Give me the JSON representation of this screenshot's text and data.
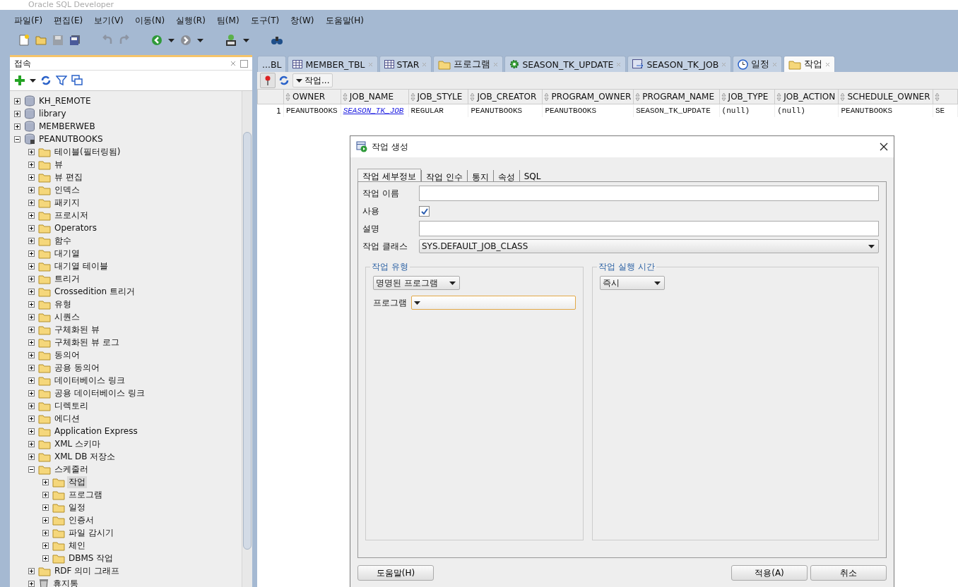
{
  "window": {
    "title": "Oracle SQL Developer"
  },
  "menu": [
    "파일(F)",
    "편집(E)",
    "보기(V)",
    "이동(N)",
    "실행(R)",
    "팀(M)",
    "도구(T)",
    "창(W)",
    "도움말(H)"
  ],
  "connections_panel": {
    "title": "접속",
    "tree": [
      {
        "label": "KH_REMOTE",
        "kind": "connection",
        "expanded": false,
        "selected": false
      },
      {
        "label": "library",
        "kind": "connection",
        "expanded": false,
        "selected": false
      },
      {
        "label": "MEMBERWEB",
        "kind": "connection",
        "expanded": false,
        "selected": false
      },
      {
        "label": "PEANUTBOOKS",
        "kind": "connection-open",
        "expanded": true,
        "selected": false,
        "children": [
          {
            "label": "테이블(필터링됨)",
            "kind": "folder",
            "expanded": false,
            "selected": false
          },
          {
            "label": "뷰",
            "kind": "folder",
            "expanded": false,
            "selected": false
          },
          {
            "label": "뷰 편집",
            "kind": "folder",
            "expanded": false,
            "selected": false
          },
          {
            "label": "인덱스",
            "kind": "folder",
            "expanded": false,
            "selected": false
          },
          {
            "label": "패키지",
            "kind": "folder",
            "expanded": false,
            "selected": false
          },
          {
            "label": "프로시저",
            "kind": "folder",
            "expanded": false,
            "selected": false
          },
          {
            "label": "Operators",
            "kind": "folder",
            "expanded": false,
            "selected": false
          },
          {
            "label": "함수",
            "kind": "folder",
            "expanded": false,
            "selected": false
          },
          {
            "label": "대기열",
            "kind": "folder",
            "expanded": false,
            "selected": false
          },
          {
            "label": "대기열 테이블",
            "kind": "folder",
            "expanded": false,
            "selected": false
          },
          {
            "label": "트리거",
            "kind": "folder",
            "expanded": false,
            "selected": false
          },
          {
            "label": "Crossedition 트리거",
            "kind": "folder",
            "expanded": false,
            "selected": false
          },
          {
            "label": "유형",
            "kind": "folder",
            "expanded": false,
            "selected": false
          },
          {
            "label": "시퀀스",
            "kind": "folder",
            "expanded": false,
            "selected": false
          },
          {
            "label": "구체화된 뷰",
            "kind": "folder",
            "expanded": false,
            "selected": false
          },
          {
            "label": "구체화된 뷰 로그",
            "kind": "folder",
            "expanded": false,
            "selected": false
          },
          {
            "label": "동의어",
            "kind": "folder",
            "expanded": false,
            "selected": false
          },
          {
            "label": "공용 동의어",
            "kind": "folder",
            "expanded": false,
            "selected": false
          },
          {
            "label": "데이터베이스 링크",
            "kind": "folder",
            "expanded": false,
            "selected": false
          },
          {
            "label": "공용 데이터베이스 링크",
            "kind": "folder",
            "expanded": false,
            "selected": false
          },
          {
            "label": "디렉토리",
            "kind": "folder",
            "expanded": false,
            "selected": false
          },
          {
            "label": "에디션",
            "kind": "folder",
            "expanded": false,
            "selected": false
          },
          {
            "label": "Application Express",
            "kind": "folder",
            "expanded": false,
            "selected": false
          },
          {
            "label": "XML 스키마",
            "kind": "folder",
            "expanded": false,
            "selected": false
          },
          {
            "label": "XML DB 저장소",
            "kind": "folder",
            "expanded": false,
            "selected": false
          },
          {
            "label": "스케줄러",
            "kind": "folder",
            "expanded": true,
            "selected": false,
            "children": [
              {
                "label": "작업",
                "kind": "folder",
                "expanded": false,
                "selected": true
              },
              {
                "label": "프로그램",
                "kind": "folder",
                "expanded": false,
                "selected": false
              },
              {
                "label": "일정",
                "kind": "folder",
                "expanded": false,
                "selected": false
              },
              {
                "label": "인증서",
                "kind": "folder",
                "expanded": false,
                "selected": false
              },
              {
                "label": "파일 감시기",
                "kind": "folder",
                "expanded": false,
                "selected": false
              },
              {
                "label": "체인",
                "kind": "folder",
                "expanded": false,
                "selected": false
              },
              {
                "label": "DBMS 작업",
                "kind": "folder",
                "expanded": false,
                "selected": false
              }
            ]
          },
          {
            "label": "RDF 의미 그래프",
            "kind": "folder",
            "expanded": false,
            "selected": false
          },
          {
            "label": "휴지통",
            "kind": "trash",
            "expanded": false,
            "selected": false
          }
        ]
      }
    ]
  },
  "editor_tabs": [
    {
      "label": "...BL",
      "kind": "none",
      "closable": false,
      "selected": false
    },
    {
      "label": "MEMBER_TBL",
      "kind": "table",
      "closable": true,
      "selected": false
    },
    {
      "label": "STAR",
      "kind": "table",
      "closable": true,
      "selected": false
    },
    {
      "label": "프로그램",
      "kind": "folder",
      "closable": true,
      "selected": false
    },
    {
      "label": "SEASON_TK_UPDATE",
      "kind": "gear",
      "closable": true,
      "selected": false
    },
    {
      "label": "SEASON_TK_JOB",
      "kind": "job",
      "closable": true,
      "selected": false
    },
    {
      "label": "일정",
      "kind": "clock",
      "closable": true,
      "selected": false
    },
    {
      "label": "작업",
      "kind": "folder",
      "closable": true,
      "selected": true
    }
  ],
  "editor_toolbar": {
    "actions_button": "작업..."
  },
  "table": {
    "columns": [
      "OWNER",
      "JOB_NAME",
      "JOB_STYLE",
      "JOB_CREATOR",
      "PROGRAM_OWNER",
      "PROGRAM_NAME",
      "JOB_TYPE",
      "JOB_ACTION",
      "SCHEDULE_OWNER"
    ],
    "rows": [
      {
        "number": "1",
        "cells": [
          {
            "text": "PEANUTBOOKS",
            "link": false
          },
          {
            "text": "SEASON_TK_JOB",
            "link": true
          },
          {
            "text": "REGULAR",
            "link": false
          },
          {
            "text": "PEANUTBOOKS",
            "link": false
          },
          {
            "text": "PEANUTBOOKS",
            "link": false
          },
          {
            "text": "SEASON_TK_UPDATE",
            "link": false
          },
          {
            "text": "(null)",
            "link": false
          },
          {
            "text": "(null)",
            "link": false
          },
          {
            "text": "PEANUTBOOKS",
            "link": false
          },
          {
            "text": "SE",
            "link": false
          }
        ]
      }
    ]
  },
  "dialog": {
    "title": "작업 생성",
    "tabs": [
      {
        "label": "작업 세부정보",
        "selected": true
      },
      {
        "label": "작업 인수",
        "selected": false
      },
      {
        "label": "통지",
        "selected": false
      },
      {
        "label": "속성",
        "selected": false
      },
      {
        "label": "SQL",
        "selected": false
      }
    ],
    "fields": [
      {
        "label": "작업 이름",
        "kind": "text"
      },
      {
        "label": "사용",
        "kind": "checkbox",
        "checked": true
      },
      {
        "label": "설명",
        "kind": "text"
      },
      {
        "label": "작업 클래스",
        "kind": "select",
        "value": "SYS.DEFAULT_JOB_CLASS"
      }
    ],
    "job_type": {
      "title": "작업 유형",
      "value": "명명된 프로그램",
      "program_label": "프로그램",
      "program_focused": true
    },
    "run_time": {
      "title": "작업 실행 시간",
      "value": "즉시"
    },
    "buttons": {
      "help": "도움말(H)",
      "apply": "적용(A)",
      "cancel": "취소"
    }
  }
}
